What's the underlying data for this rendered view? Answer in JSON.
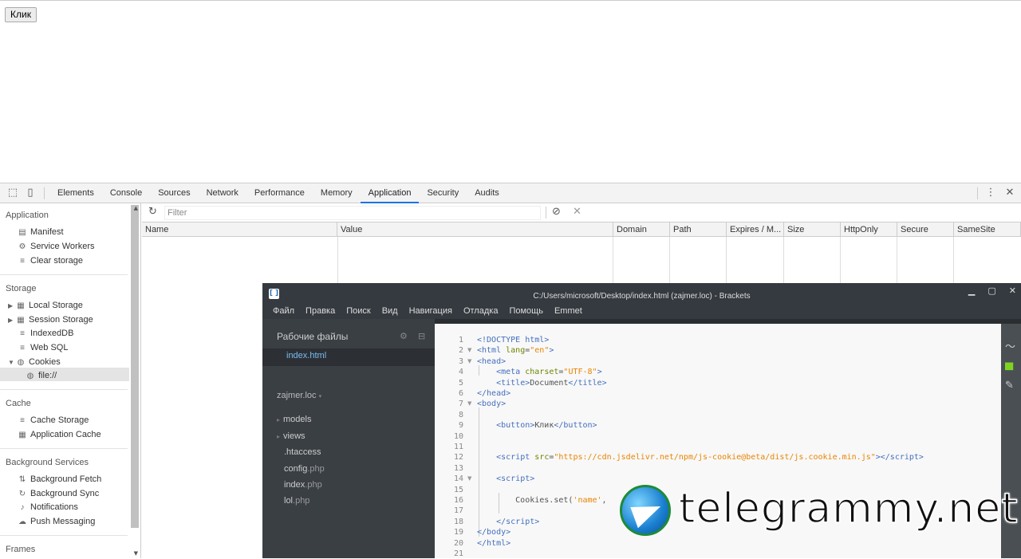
{
  "page": {
    "button_label": "Клик"
  },
  "devtools": {
    "tabs": [
      "Elements",
      "Console",
      "Sources",
      "Network",
      "Performance",
      "Memory",
      "Application",
      "Security",
      "Audits"
    ],
    "active_tab": "Application",
    "sidebar": {
      "application_header": "Application",
      "application_items": [
        "Manifest",
        "Service Workers",
        "Clear storage"
      ],
      "storage_header": "Storage",
      "storage_items": [
        "Local Storage",
        "Session Storage",
        "IndexedDB",
        "Web SQL",
        "Cookies"
      ],
      "cookie_child": "file://",
      "cache_header": "Cache",
      "cache_items": [
        "Cache Storage",
        "Application Cache"
      ],
      "bg_header": "Background Services",
      "bg_items": [
        "Background Fetch",
        "Background Sync",
        "Notifications",
        "Push Messaging"
      ],
      "frames_header": "Frames"
    },
    "filter_placeholder": "Filter",
    "columns": [
      "Name",
      "Value",
      "Domain",
      "Path",
      "Expires / M...",
      "Size",
      "HttpOnly",
      "Secure",
      "SameSite"
    ]
  },
  "brackets": {
    "title": "C:/Users/microsoft/Desktop/index.html (zajmer.loc) - Brackets",
    "menu": [
      "Файл",
      "Правка",
      "Поиск",
      "Вид",
      "Навигация",
      "Отладка",
      "Помощь",
      "Emmet"
    ],
    "working_files_header": "Рабочие файлы",
    "working_file": "index.html",
    "project": "zajmer.loc",
    "tree": [
      {
        "name": "models",
        "ext": "",
        "folder": true
      },
      {
        "name": "views",
        "ext": "",
        "folder": true
      },
      {
        "name": ".htaccess",
        "ext": "",
        "folder": false
      },
      {
        "name": "config",
        "ext": ".php",
        "folder": false
      },
      {
        "name": "index",
        "ext": ".php",
        "folder": false
      },
      {
        "name": "lol",
        "ext": ".php",
        "folder": false
      }
    ],
    "line_numbers": [
      "1",
      "2",
      "3",
      "4",
      "5",
      "6",
      "7",
      "8",
      "9",
      "10",
      "11",
      "12",
      "13",
      "14",
      "15",
      "16",
      "17",
      "18",
      "19",
      "20",
      "21"
    ]
  },
  "watermark": "telegrammy.net"
}
